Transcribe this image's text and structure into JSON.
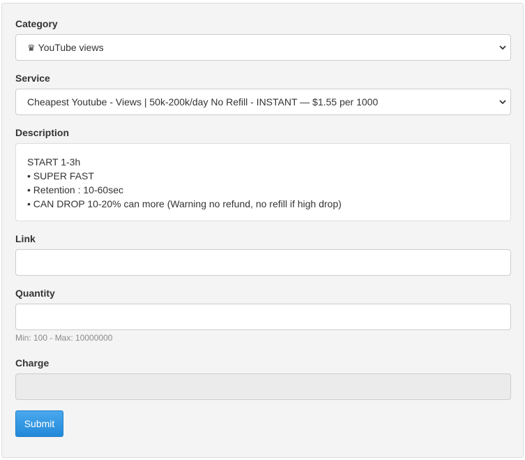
{
  "form": {
    "category": {
      "label": "Category",
      "icon": "crown-icon",
      "icon_glyph": "♛",
      "selected": "YouTube views"
    },
    "service": {
      "label": "Service",
      "selected": "Cheapest Youtube - Views | 50k-200k/day No Refill - INSTANT — $1.55 per 1000"
    },
    "description": {
      "label": "Description",
      "lines": [
        "START 1-3h",
        "• SUPER FAST",
        "• Retention : 10-60sec",
        "• CAN DROP 10-20% can more (Warning no refund, no refill if high drop)"
      ]
    },
    "link": {
      "label": "Link",
      "value": "",
      "placeholder": ""
    },
    "quantity": {
      "label": "Quantity",
      "value": "",
      "placeholder": "",
      "help": "Min: 100 - Max: 10000000"
    },
    "charge": {
      "label": "Charge",
      "value": ""
    },
    "submit_label": "Submit"
  },
  "colors": {
    "panel_bg": "#f4f4f4",
    "submit_bg": "#2a90dc",
    "help_text": "#8a8a8a"
  }
}
